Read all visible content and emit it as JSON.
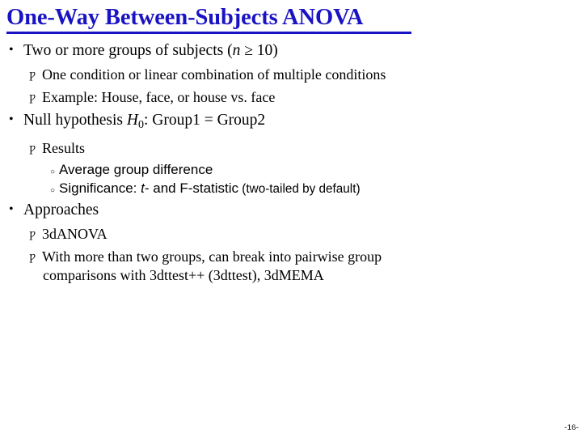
{
  "slide": {
    "title": "One-Way Between-Subjects ANOVA",
    "title_color": "#1a13c4",
    "page_number": "-16-",
    "markers": {
      "level1": "•",
      "level2": "Ƿ",
      "level3": "○"
    },
    "bullets": [
      {
        "level": 1,
        "id": "two-or-more-groups",
        "text_before": "Two or more groups of subjects (",
        "italic": "n",
        "text_after": " ≥ 10)"
      },
      {
        "level": 2,
        "id": "one-condition",
        "text": "One condition or linear combination of multiple conditions"
      },
      {
        "level": 2,
        "id": "example-house-face",
        "text": "Example: House, face, or house vs. face"
      },
      {
        "level": 1,
        "id": "null-hypothesis",
        "text_before": "Null hypothesis ",
        "italic": "H",
        "subscript": "0",
        "text_after": ": Group1 = Group2"
      },
      {
        "level": 2,
        "id": "results",
        "text": "Results"
      },
      {
        "level": 3,
        "id": "average-group-difference",
        "text": "Average group difference"
      },
      {
        "level": 3,
        "id": "significance",
        "text_before": "Significance: ",
        "italic": "t",
        "text_after": "- and F-statistic",
        "text_small": " (two-tailed by default)"
      },
      {
        "level": 1,
        "id": "approaches",
        "text": "Approaches"
      },
      {
        "level": 2,
        "id": "3danova",
        "text": "3dANOVA"
      },
      {
        "level": 2,
        "id": "pairwise-comparisons",
        "line1": "With more than two groups, can break into pairwise group",
        "line2": "comparisons with 3dttest++ (3dttest), 3dMEMA"
      }
    ]
  }
}
